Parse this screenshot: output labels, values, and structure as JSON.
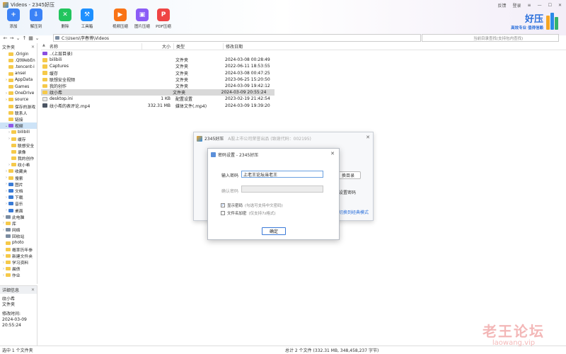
{
  "window": {
    "title": "Videos - 2345好压",
    "controls": [
      "反馈",
      "登录"
    ]
  },
  "toolbar": {
    "buttons": [
      {
        "label": "添加",
        "icon": "add-icon",
        "color": "#3b82f6"
      },
      {
        "label": "解压到",
        "icon": "extract-icon",
        "color": "#3b82f6"
      },
      {
        "label": "删除",
        "icon": "delete-icon",
        "color": "#22c55e"
      },
      {
        "label": "工具箱",
        "icon": "toolbox-icon",
        "color": "#1e90ff"
      },
      {
        "label": "视频压缩",
        "icon": "video-compress-icon",
        "color": "#f97316"
      },
      {
        "label": "图片压缩",
        "icon": "image-compress-icon",
        "color": "#8b5cf6"
      },
      {
        "label": "PDF压缩",
        "icon": "pdf-compress-icon",
        "color": "#ef4444"
      }
    ]
  },
  "brand": {
    "name": "好压",
    "slogan": "高效专业 值得信赖"
  },
  "address": {
    "path": "C:\\Users\\李春博\\Videos",
    "search_placeholder": "当前目录查找(支持包内查找)"
  },
  "sidebar": {
    "header": "文件夹",
    "items": [
      {
        "label": ".Origin",
        "indent": 1,
        "twisty": "",
        "icon": "folder"
      },
      {
        "label": ".QtWebEn",
        "indent": 1,
        "twisty": "",
        "icon": "folder"
      },
      {
        "label": ".tencent-i",
        "indent": 1,
        "twisty": "",
        "icon": "folder"
      },
      {
        "label": "ansel",
        "indent": 1,
        "twisty": "",
        "icon": "folder"
      },
      {
        "label": "AppData",
        "indent": 1,
        "twisty": "›",
        "icon": "folder"
      },
      {
        "label": "Games",
        "indent": 1,
        "twisty": "",
        "icon": "folder"
      },
      {
        "label": "OneDrive",
        "indent": 1,
        "twisty": "›",
        "icon": "folder"
      },
      {
        "label": "source",
        "indent": 1,
        "twisty": "›",
        "icon": "folder"
      },
      {
        "label": "保存的游戏",
        "indent": 1,
        "twisty": "",
        "icon": "folder"
      },
      {
        "label": "联系人",
        "indent": 1,
        "twisty": "",
        "icon": "folder"
      },
      {
        "label": "链接",
        "indent": 1,
        "twisty": "",
        "icon": "folder"
      },
      {
        "label": "视频",
        "indent": 1,
        "twisty": "⌄",
        "icon": "purple",
        "selected": true
      },
      {
        "label": "bilibili",
        "indent": 2,
        "twisty": "›",
        "icon": "folder"
      },
      {
        "label": "缓存",
        "indent": 2,
        "twisty": "›",
        "icon": "folder"
      },
      {
        "label": "联想安全",
        "indent": 2,
        "twisty": "",
        "icon": "folder"
      },
      {
        "label": "录像",
        "indent": 2,
        "twisty": "",
        "icon": "folder"
      },
      {
        "label": "我的创作",
        "indent": 2,
        "twisty": "",
        "icon": "folder"
      },
      {
        "label": "纹小希",
        "indent": 2,
        "twisty": "›",
        "icon": "folder"
      },
      {
        "label": "收藏夹",
        "indent": 1,
        "twisty": "›",
        "icon": "folder"
      },
      {
        "label": "搜索",
        "indent": 1,
        "twisty": "›",
        "icon": "folder"
      },
      {
        "label": "图片",
        "indent": 1,
        "twisty": "›",
        "icon": "blue"
      },
      {
        "label": "文档",
        "indent": 1,
        "twisty": "›",
        "icon": "blue"
      },
      {
        "label": "下载",
        "indent": 1,
        "twisty": "›",
        "icon": "blue"
      },
      {
        "label": "音乐",
        "indent": 1,
        "twisty": "›",
        "icon": "blue"
      },
      {
        "label": "桌面",
        "indent": 1,
        "twisty": "›",
        "icon": "blue"
      },
      {
        "label": "此电脑",
        "indent": 0,
        "twisty": "›",
        "icon": "gray"
      },
      {
        "label": "库",
        "indent": 0,
        "twisty": "›",
        "icon": "folder"
      },
      {
        "label": "网络",
        "indent": 0,
        "twisty": "›",
        "icon": "gray"
      },
      {
        "label": "回收站",
        "indent": 0,
        "twisty": "",
        "icon": "gray"
      },
      {
        "label": "photo",
        "indent": 0,
        "twisty": "",
        "icon": "folder"
      },
      {
        "label": "概率历年参",
        "indent": 0,
        "twisty": "",
        "icon": "folder"
      },
      {
        "label": "新建文件夹",
        "indent": 0,
        "twisty": "›",
        "icon": "folder"
      },
      {
        "label": "学习资料",
        "indent": 0,
        "twisty": "›",
        "icon": "folder"
      },
      {
        "label": "晨债",
        "indent": 0,
        "twisty": "›",
        "icon": "folder"
      },
      {
        "label": "作业",
        "indent": 0,
        "twisty": "›",
        "icon": "folder"
      }
    ]
  },
  "details": {
    "header": "详细信息",
    "name": "纹小希",
    "type": "文件夹",
    "modified_label": "修改时间:",
    "modified_date": "2024-03-09",
    "modified_time": "20:55:24"
  },
  "columns": {
    "name": "名称",
    "size": "大小",
    "type": "类型",
    "date": "修改日期"
  },
  "files": [
    {
      "name": "..(上层目录)",
      "size": "",
      "type": "",
      "date": "",
      "icon": "up"
    },
    {
      "name": "bilibili",
      "size": "",
      "type": "文件夹",
      "date": "2024-03-08 00:28:49",
      "icon": "folder"
    },
    {
      "name": "Captures",
      "size": "",
      "type": "文件夹",
      "date": "2022-06-11 18:53:55",
      "icon": "folder"
    },
    {
      "name": "缓存",
      "size": "",
      "type": "文件夹",
      "date": "2024-03-08 00:47:25",
      "icon": "folder"
    },
    {
      "name": "联想安全视频",
      "size": "",
      "type": "文件夹",
      "date": "2023-06-25 15:20:50",
      "icon": "folder"
    },
    {
      "name": "我的创作",
      "size": "",
      "type": "文件夹",
      "date": "2024-03-09 19:42:12",
      "icon": "folder"
    },
    {
      "name": "纹小希",
      "size": "",
      "type": "文件夹",
      "date": "2024-03-09 20:55:24",
      "icon": "folder",
      "selected": true
    },
    {
      "name": "desktop.ini",
      "size": "1 KB",
      "type": "配置设置",
      "date": "2023-02-19 21:42:54",
      "icon": "ini"
    },
    {
      "name": "纹小希的表评论.mp4",
      "size": "332.31 MB",
      "type": "媒体文件(.mp4)",
      "date": "2024-03-09 19:39:20",
      "icon": "video"
    }
  ],
  "status": {
    "left": "选中 1 个文件夹",
    "right": "总计 2 个文件 (332.31 MB, 348,458,237 字节)"
  },
  "bg_dialog": {
    "title": "2345好压",
    "subtitle": "A股上市公司荣誉出品 (致谢代码：002195)",
    "dir_button": "换目录",
    "pwd_setting": "设置密码",
    "classic": "切换到经典模式"
  },
  "pwd_dialog": {
    "title": "密码设置 - 2345好压",
    "enter_label": "输入密码",
    "enter_value": "上老王论坛当老王",
    "confirm_label": "确认密码",
    "confirm_value": "",
    "show_pwd": "显示密码",
    "show_pwd_hint": "(勾选可支持中文密码)",
    "encrypt_names": "文件名加密",
    "encrypt_names_hint": "(仅支持7z格式)",
    "ok": "确定"
  },
  "watermark": {
    "text": "老王论坛",
    "url": "laowang.vip"
  }
}
